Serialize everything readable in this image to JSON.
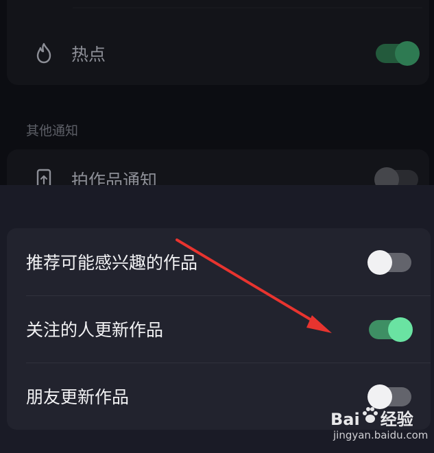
{
  "background": {
    "rows": [
      {
        "label": "热点",
        "icon": "flame-icon",
        "toggle_on": true
      },
      {
        "label": "拍作品通知",
        "icon": "phone-upload-icon",
        "toggle_on": false
      }
    ],
    "section_label": "其他通知"
  },
  "sheet": {
    "options": [
      {
        "label": "推荐可能感兴趣的作品",
        "toggle_on": false
      },
      {
        "label": "关注的人更新作品",
        "toggle_on": true
      },
      {
        "label": "朋友更新作品",
        "toggle_on": false
      }
    ]
  },
  "annotation": {
    "arrow_color": "#e8342f"
  },
  "watermark": {
    "brand": "Bai百度经验",
    "brand_left": "Bai",
    "brand_right": "经验",
    "url": "jingyan.baidu.com"
  },
  "colors": {
    "accent_on": "#6ae3a2",
    "track_on": "#3e8f64",
    "track_off": "#63646c"
  }
}
